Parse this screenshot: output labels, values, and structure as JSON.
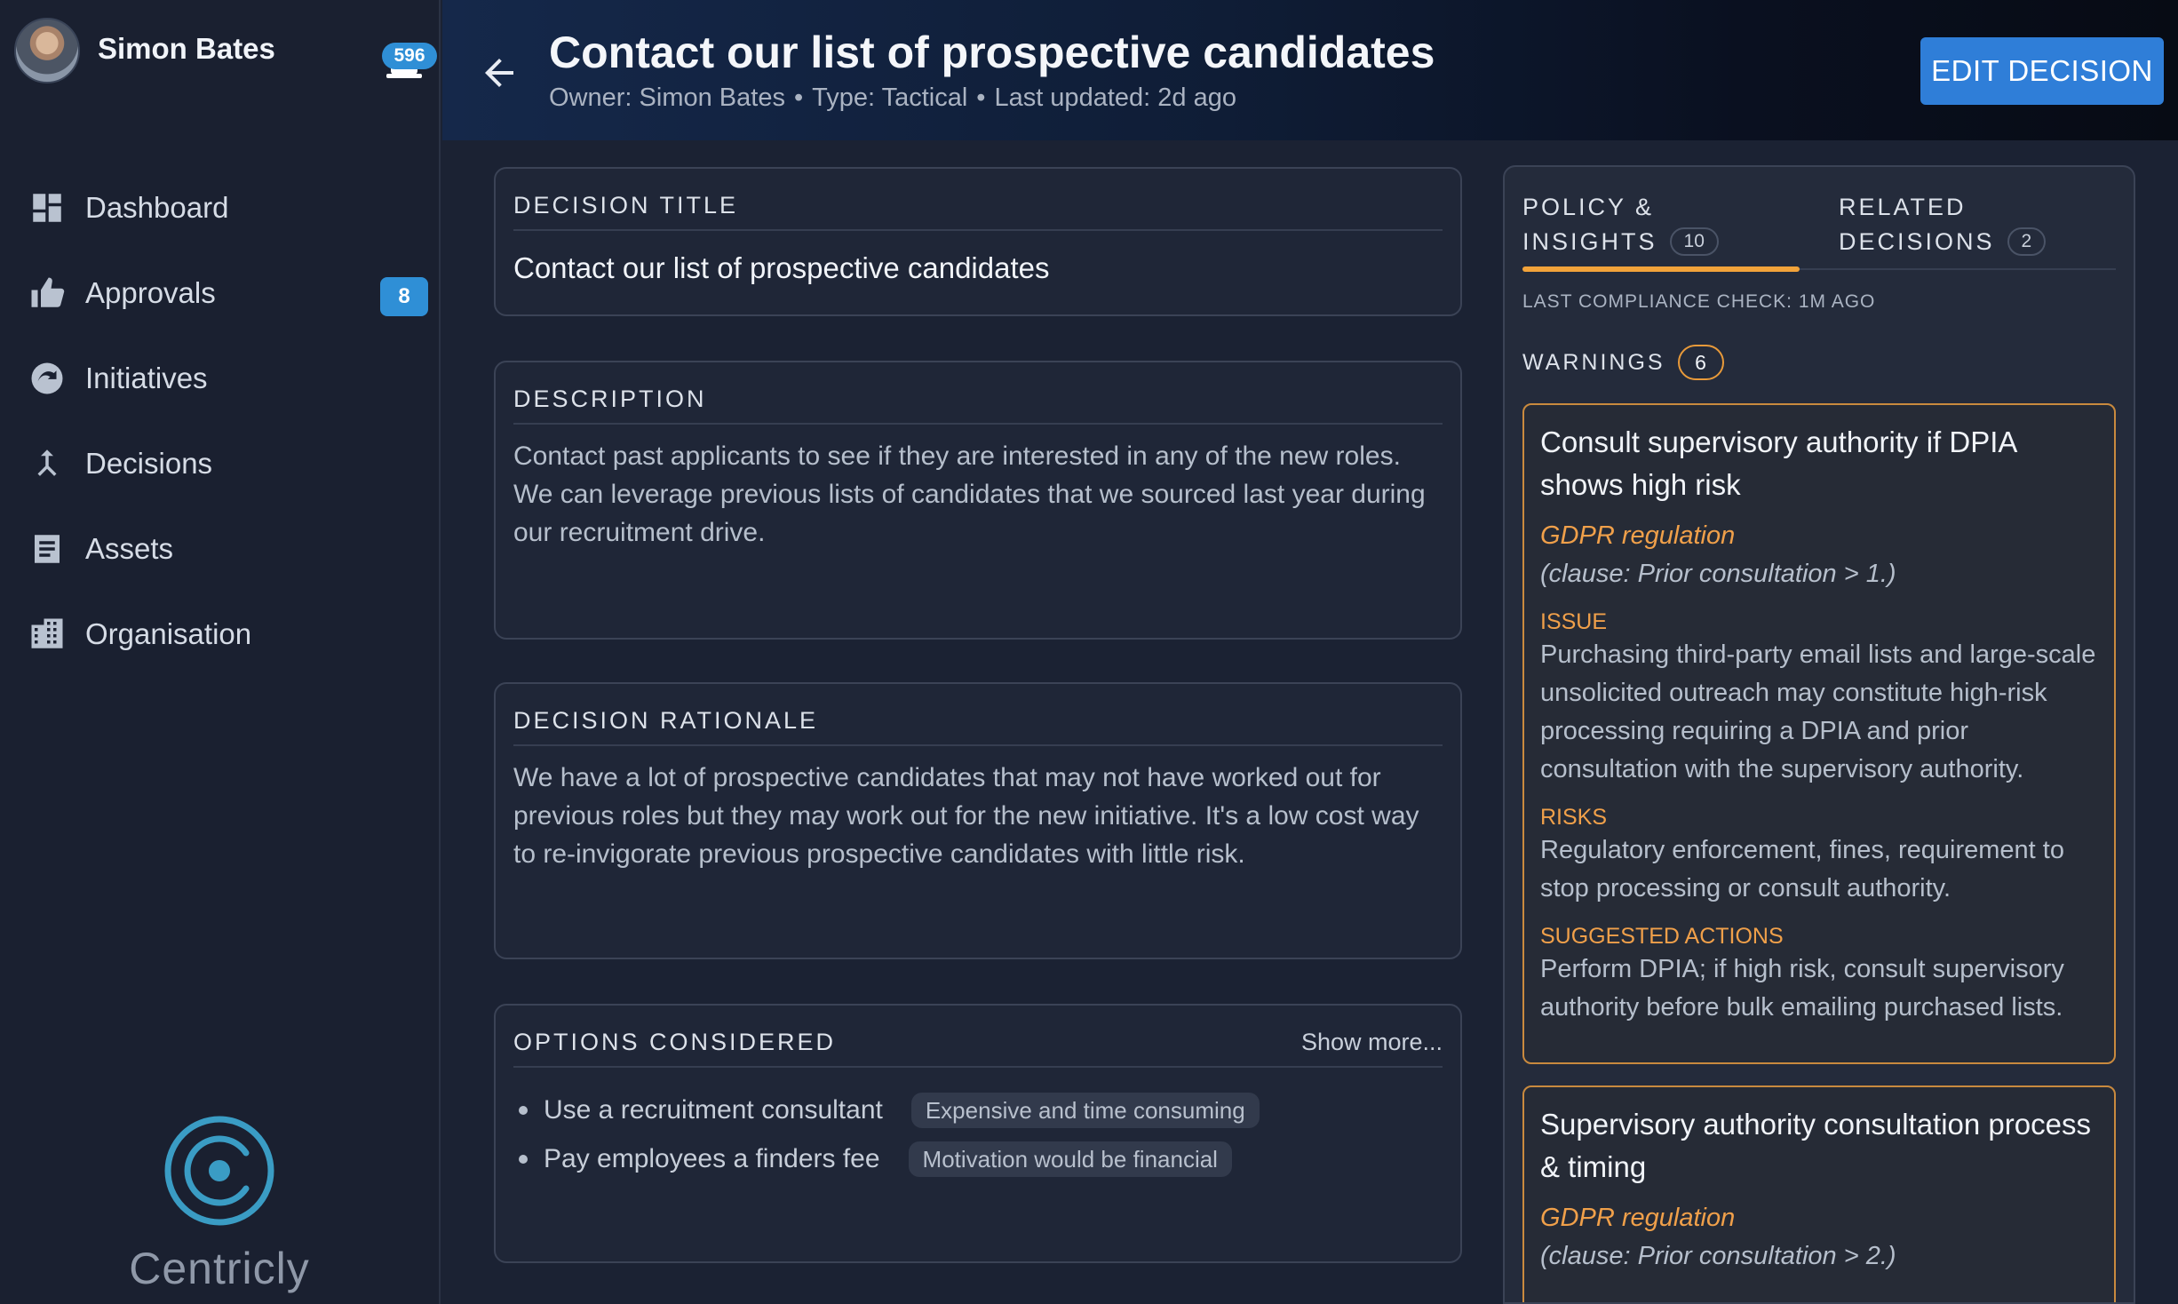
{
  "user": {
    "name": "Simon Bates",
    "notifications": "596"
  },
  "nav": [
    {
      "label": "Dashboard",
      "icon": "dashboard-icon"
    },
    {
      "label": "Approvals",
      "icon": "thumbs-up-icon",
      "badge": "8"
    },
    {
      "label": "Initiatives",
      "icon": "initiatives-icon"
    },
    {
      "label": "Decisions",
      "icon": "merge-arrow-icon"
    },
    {
      "label": "Assets",
      "icon": "document-icon"
    },
    {
      "label": "Organisation",
      "icon": "building-icon"
    }
  ],
  "brand": {
    "name": "Centricly",
    "icon": "centricly-logo-icon"
  },
  "header": {
    "title": "Contact our list of prospective candidates",
    "owner": "Owner: Simon Bates",
    "type": "Type: Tactical",
    "updated": "Last updated: 2d ago",
    "edit_label": "EDIT DECISION"
  },
  "cards": {
    "title": {
      "label": "DECISION TITLE",
      "value": "Contact our list of prospective candidates"
    },
    "description": {
      "label": "DESCRIPTION",
      "text": "Contact past applicants to see if they are interested in any of the new roles. We can leverage previous lists of candidates that we sourced last year during our recruitment drive."
    },
    "rationale": {
      "label": "DECISION RATIONALE",
      "text": "We have a lot of prospective candidates that may not have worked out for previous roles but they may work out for the new initiative. It's a low cost way to re-invigorate previous prospective candidates with little risk."
    },
    "options": {
      "label": "OPTIONS CONSIDERED",
      "show_more": "Show more...",
      "items": [
        {
          "text": "Use a recruitment consultant",
          "note": "Expensive and time consuming"
        },
        {
          "text": "Pay employees a finders fee",
          "note": "Motivation would be financial"
        }
      ]
    }
  },
  "panel": {
    "tabs": [
      {
        "line1": "POLICY &",
        "line2": "INSIGHTS",
        "count": "10"
      },
      {
        "line1": "RELATED",
        "line2": "DECISIONS",
        "count": "2"
      }
    ],
    "compliance": "LAST COMPLIANCE CHECK: 1M AGO",
    "warnings_label": "WARNINGS",
    "warnings_count": "6",
    "warnings": [
      {
        "title": "Consult supervisory authority if DPIA shows high risk",
        "regulation": "GDPR regulation",
        "clause": "(clause: Prior consultation > 1.)",
        "issue_label": "ISSUE",
        "issue": "Purchasing third-party email lists and large-scale unsolicited outreach may constitute high-risk processing requiring a DPIA and prior consultation with the supervisory authority.",
        "risks_label": "RISKS",
        "risks": "Regulatory enforcement, fines, requirement to stop processing or consult authority.",
        "actions_label": "SUGGESTED ACTIONS",
        "actions": "Perform DPIA; if high risk, consult supervisory authority before bulk emailing purchased lists."
      },
      {
        "title": "Supervisory authority consultation process & timing",
        "regulation": "GDPR regulation",
        "clause": "(clause: Prior consultation > 2.)"
      }
    ]
  },
  "colors": {
    "accent": "#2f7ed8",
    "warning": "#f0a04a",
    "sidebar": "#1a2030"
  }
}
